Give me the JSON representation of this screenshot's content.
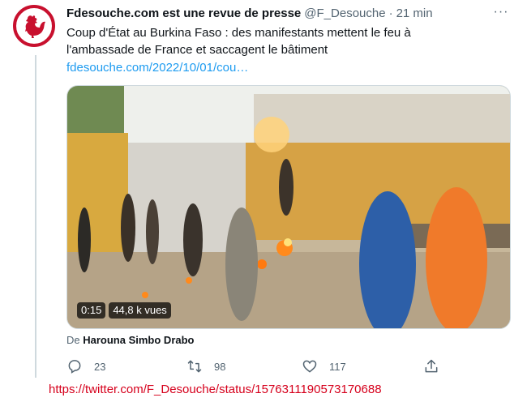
{
  "tweet": {
    "display_name": "Fdesouche.com est une revue de presse",
    "handle": "@F_Desouche",
    "separator": "·",
    "time": "21 min",
    "more_label": "···",
    "text": "Coup d'État au Burkina Faso : des manifestants mettent le feu à l'ambassade de France et saccagent le bâtiment",
    "link": "fdesouche.com/2022/10/01/cou…",
    "avatar_icon": "rooster-icon",
    "brand_color": "#c8102e",
    "link_color": "#1d9bf0"
  },
  "media": {
    "duration": "0:15",
    "views": "44,8 k vues"
  },
  "attribution": {
    "prefix": "De",
    "author": "Harouna Simbo Drabo"
  },
  "actions": {
    "replies": "23",
    "retweets": "98",
    "likes": "117",
    "reply_icon": "reply-icon",
    "retweet_icon": "retweet-icon",
    "like_icon": "heart-icon",
    "share_icon": "share-icon"
  },
  "source_url": "https://twitter.com/F_Desouche/status/1576311190573170688"
}
